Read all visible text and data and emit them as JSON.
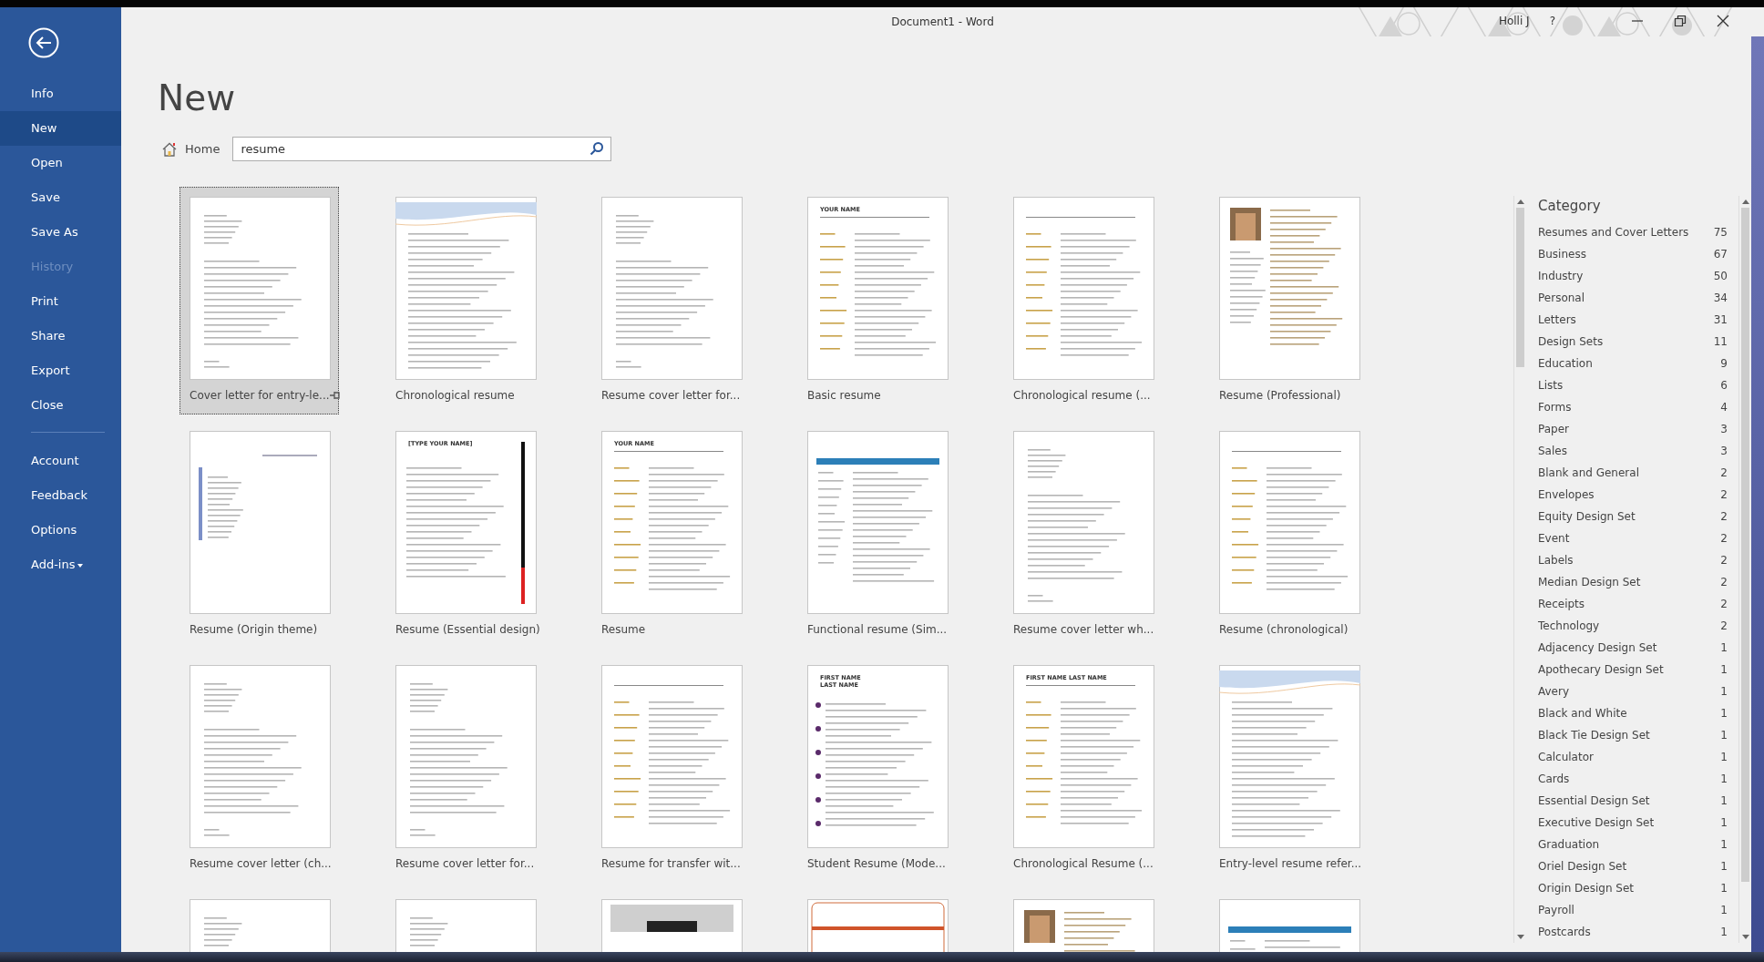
{
  "window": {
    "title": "Document1  -  Word",
    "user": "Holli J",
    "help": "?"
  },
  "sidebar": {
    "items": [
      {
        "label": "Info",
        "selected": false,
        "disabled": false
      },
      {
        "label": "New",
        "selected": true,
        "disabled": false
      },
      {
        "label": "Open",
        "selected": false,
        "disabled": false
      },
      {
        "label": "Save",
        "selected": false,
        "disabled": false
      },
      {
        "label": "Save As",
        "selected": false,
        "disabled": false
      },
      {
        "label": "History",
        "selected": false,
        "disabled": true
      },
      {
        "label": "Print",
        "selected": false,
        "disabled": false
      },
      {
        "label": "Share",
        "selected": false,
        "disabled": false
      },
      {
        "label": "Export",
        "selected": false,
        "disabled": false
      },
      {
        "label": "Close",
        "selected": false,
        "disabled": false
      },
      {
        "label": "Account",
        "selected": false,
        "disabled": false,
        "separator_before": true
      },
      {
        "label": "Feedback",
        "selected": false,
        "disabled": false
      },
      {
        "label": "Options",
        "selected": false,
        "disabled": false
      },
      {
        "label": "Add-ins",
        "selected": false,
        "disabled": false,
        "dropdown": true
      }
    ]
  },
  "page": {
    "heading": "New",
    "home": "Home",
    "search": {
      "value": "resume"
    }
  },
  "templates": [
    {
      "label": "Cover letter for entry-le...",
      "selected": true,
      "pinned": true,
      "kind": "letter"
    },
    {
      "label": "Chronological resume",
      "selected": false,
      "kind": "wave"
    },
    {
      "label": "Resume cover letter for...",
      "selected": false,
      "kind": "letter"
    },
    {
      "label": "Basic resume",
      "selected": false,
      "kind": "sections",
      "heading": "YOUR NAME"
    },
    {
      "label": "Chronological resume (...",
      "selected": false,
      "kind": "sections"
    },
    {
      "label": "Resume (Professional)",
      "selected": false,
      "kind": "photo"
    },
    {
      "label": "Resume (Origin theme)",
      "selected": false,
      "kind": "sidebar"
    },
    {
      "label": "Resume (Essential design)",
      "selected": false,
      "kind": "redbar",
      "heading": "[TYPE YOUR NAME]"
    },
    {
      "label": "Resume",
      "selected": false,
      "kind": "sections",
      "heading": "YOUR NAME"
    },
    {
      "label": "Functional resume (Sim...",
      "selected": false,
      "kind": "band"
    },
    {
      "label": "Resume cover letter wh...",
      "selected": false,
      "kind": "letter"
    },
    {
      "label": "Resume (chronological)",
      "selected": false,
      "kind": "sections"
    },
    {
      "label": "Resume cover letter (ch...",
      "selected": false,
      "kind": "letter"
    },
    {
      "label": "Resume cover letter for...",
      "selected": false,
      "kind": "letter"
    },
    {
      "label": "Resume for transfer wit...",
      "selected": false,
      "kind": "sections"
    },
    {
      "label": "Student Resume (Mode...",
      "selected": false,
      "kind": "timeline",
      "heading": "FIRST NAME\nLAST NAME"
    },
    {
      "label": "Chronological Resume (...",
      "selected": false,
      "kind": "sections",
      "heading": "FIRST NAME LAST NAME"
    },
    {
      "label": "Entry-level resume refer...",
      "selected": false,
      "kind": "wave"
    },
    {
      "selected": false,
      "kind": "letter"
    },
    {
      "selected": false,
      "kind": "letter"
    },
    {
      "selected": false,
      "kind": "pattern"
    },
    {
      "selected": false,
      "kind": "orange"
    },
    {
      "selected": false,
      "kind": "photo"
    },
    {
      "selected": false,
      "kind": "band"
    }
  ],
  "category": {
    "title": "Category",
    "items": [
      {
        "name": "Resumes and Cover Letters",
        "count": "75"
      },
      {
        "name": "Business",
        "count": "67"
      },
      {
        "name": "Industry",
        "count": "50"
      },
      {
        "name": "Personal",
        "count": "34"
      },
      {
        "name": "Letters",
        "count": "31"
      },
      {
        "name": "Design Sets",
        "count": "11"
      },
      {
        "name": "Education",
        "count": "9"
      },
      {
        "name": "Lists",
        "count": "6"
      },
      {
        "name": "Forms",
        "count": "4"
      },
      {
        "name": "Paper",
        "count": "3"
      },
      {
        "name": "Sales",
        "count": "3"
      },
      {
        "name": "Blank and General",
        "count": "2"
      },
      {
        "name": "Envelopes",
        "count": "2"
      },
      {
        "name": "Equity Design Set",
        "count": "2"
      },
      {
        "name": "Event",
        "count": "2"
      },
      {
        "name": "Labels",
        "count": "2"
      },
      {
        "name": "Median Design Set",
        "count": "2"
      },
      {
        "name": "Receipts",
        "count": "2"
      },
      {
        "name": "Technology",
        "count": "2"
      },
      {
        "name": "Adjacency Design Set",
        "count": "1"
      },
      {
        "name": "Apothecary Design Set",
        "count": "1"
      },
      {
        "name": "Avery",
        "count": "1"
      },
      {
        "name": "Black and White",
        "count": "1"
      },
      {
        "name": "Black Tie Design Set",
        "count": "1"
      },
      {
        "name": "Calculator",
        "count": "1"
      },
      {
        "name": "Cards",
        "count": "1"
      },
      {
        "name": "Essential Design Set",
        "count": "1"
      },
      {
        "name": "Executive Design Set",
        "count": "1"
      },
      {
        "name": "Graduation",
        "count": "1"
      },
      {
        "name": "Oriel Design Set",
        "count": "1"
      },
      {
        "name": "Origin Design Set",
        "count": "1"
      },
      {
        "name": "Payroll",
        "count": "1"
      },
      {
        "name": "Postcards",
        "count": "1"
      }
    ]
  }
}
